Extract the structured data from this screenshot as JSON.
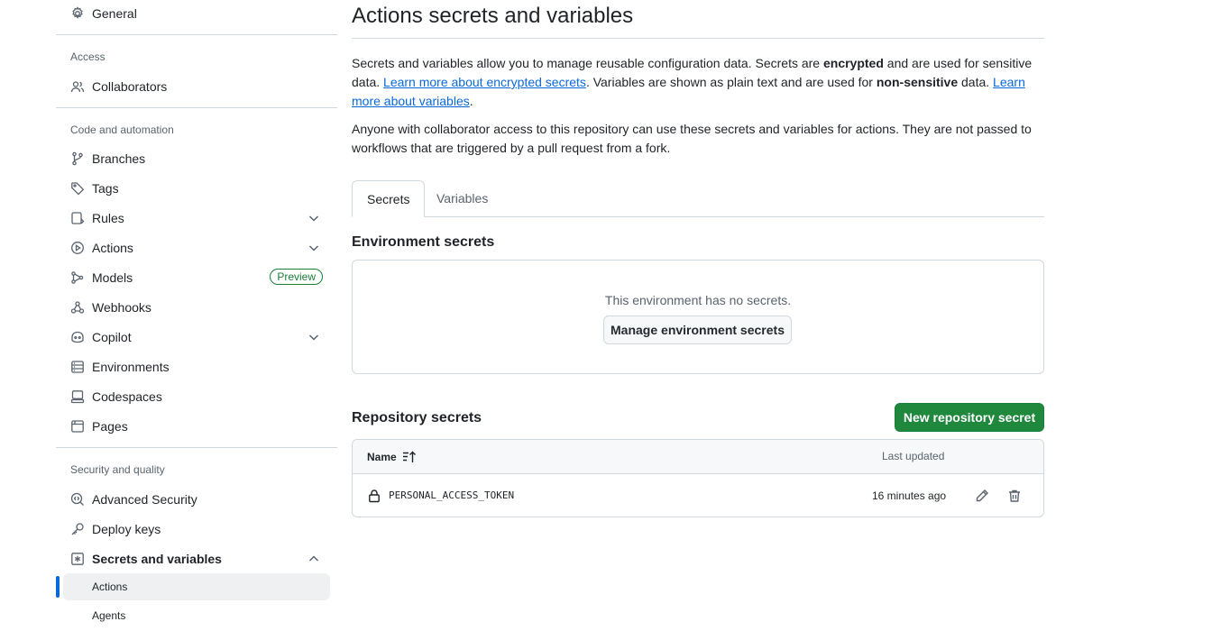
{
  "sidebar": {
    "general": "General",
    "access_section": "Access",
    "collaborators": "Collaborators",
    "code_section": "Code and automation",
    "branches": "Branches",
    "tags": "Tags",
    "rules": "Rules",
    "actions": "Actions",
    "models": "Models",
    "models_badge": "Preview",
    "webhooks": "Webhooks",
    "copilot": "Copilot",
    "environments": "Environments",
    "codespaces": "Codespaces",
    "pages": "Pages",
    "security_section": "Security and quality",
    "advanced_security": "Advanced Security",
    "deploy_keys": "Deploy keys",
    "secrets_and_variables": "Secrets and variables",
    "sub_actions": "Actions",
    "sub_agents": "Agents"
  },
  "main": {
    "title": "Actions secrets and variables",
    "intro": {
      "p1_a": "Secrets and variables allow you to manage reusable configuration data. Secrets are ",
      "p1_b": "encrypted",
      "p1_c": " and are used for sensitive data. ",
      "p1_link1": "Learn more about encrypted secrets",
      "p1_d": ". Variables are shown as plain text and are used for ",
      "p1_e": "non-sensitive",
      "p1_f": " data. ",
      "p1_link2": "Learn more about variables",
      "p1_g": ".",
      "p2": "Anyone with collaborator access to this repository can use these secrets and variables for actions. They are not passed to workflows that are triggered by a pull request from a fork."
    },
    "tabs": [
      "Secrets",
      "Variables"
    ],
    "environment_secrets": {
      "heading": "Environment secrets",
      "empty_message": "This environment has no secrets.",
      "manage_button": "Manage environment secrets"
    },
    "repository_secrets": {
      "heading": "Repository secrets",
      "new_button": "New repository secret",
      "columns": {
        "name": "Name",
        "last_updated": "Last updated"
      },
      "rows": [
        {
          "name": "PERSONAL_ACCESS_TOKEN",
          "updated": "16 minutes ago"
        }
      ]
    }
  },
  "colors": {
    "primary_button": "#1f883d",
    "link": "#0969da",
    "preview_badge": "#1a7f37",
    "active_indicator": "#0969da"
  }
}
